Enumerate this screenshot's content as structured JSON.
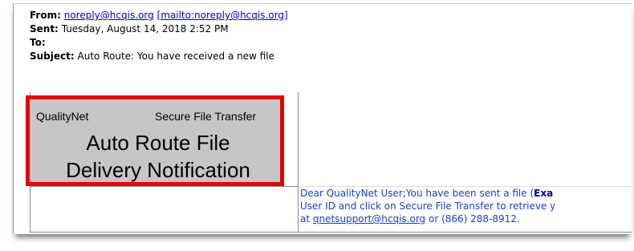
{
  "email": {
    "from_label": "From:",
    "from_address": "noreply@hcqis.org",
    "from_mailto": "[mailto:noreply@hcqis.org]",
    "sent_label": "Sent:",
    "sent_value": "Tuesday, August 14, 2018 2:52 PM",
    "to_label": "To:",
    "subject_label": "Subject:",
    "subject_value": "Auto Route: You have received a new file"
  },
  "banner": {
    "left_label": "QualityNet",
    "right_label": "Secure File Transfer",
    "title_line1": "Auto Route File",
    "title_line2": "Delivery Notification",
    "highlight_color": "#e60000"
  },
  "message": {
    "line1_text": "Dear QualityNet User;You have been sent a file (",
    "line1_bold": "Exa",
    "line2_text": "User ID and click on Secure File Transfer to retrieve y",
    "line3_prefix": "at ",
    "line3_link": "qnetsupport@hcqis.org",
    "line3_suffix": " or (866) 288-8912."
  }
}
